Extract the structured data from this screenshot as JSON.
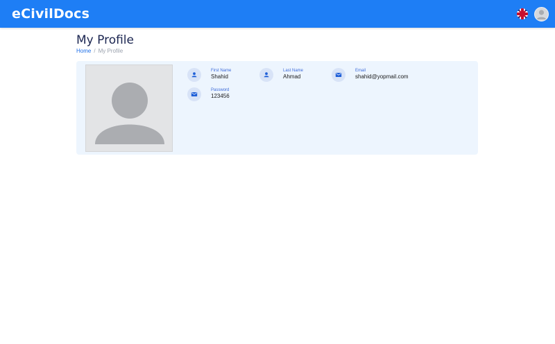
{
  "header": {
    "brand": "eCivilDocs",
    "language_flag_icon": "uk-flag-icon",
    "user_avatar_icon": "user-avatar-icon",
    "colors": {
      "bar": "#1e7ef5"
    }
  },
  "page": {
    "title": "My Profile",
    "breadcrumb": {
      "home": "Home",
      "separator": "/",
      "current": "My Profile"
    }
  },
  "profile": {
    "photo_icon": "user-placeholder-icon",
    "fields": [
      {
        "label": "First Name",
        "value": "Shahid",
        "icon": "person-icon"
      },
      {
        "label": "Last Name",
        "value": "Ahmad",
        "icon": "person-icon"
      },
      {
        "label": "Email",
        "value": "shahid@yopmail.com",
        "icon": "envelope-icon"
      },
      {
        "label": "Password",
        "value": "123456",
        "icon": "envelope-icon"
      }
    ]
  }
}
